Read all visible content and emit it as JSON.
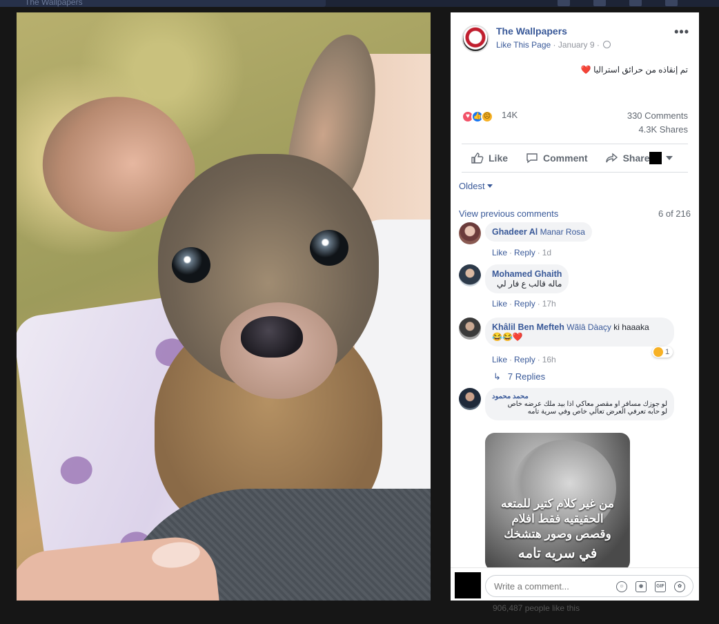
{
  "background": {
    "tab_title": "The Wallpapers",
    "bottom_text": "906,487 people like this"
  },
  "post": {
    "page_name": "The Wallpapers",
    "like_page": "Like This Page",
    "date": "January 9",
    "text": "تم إنقاذه من حرائق استراليا",
    "heart": "❤️",
    "reaction_count": "14K",
    "comments_count": "330 Comments",
    "shares_count": "4.3K Shares",
    "actions": {
      "like": "Like",
      "comment": "Comment",
      "share": "Share"
    }
  },
  "comments_section": {
    "sort_label": "Oldest",
    "view_previous": "View previous comments",
    "count": "6 of 216",
    "comments": [
      {
        "name": "Ghadeer Al",
        "tag": "Manar Rosa",
        "text": "",
        "like": "Like",
        "reply": "Reply",
        "time": "1d"
      },
      {
        "name": "Mohamed Ghaith",
        "tag": "",
        "text": "ماله قالب ع فار لي",
        "like": "Like",
        "reply": "Reply",
        "time": "17h"
      },
      {
        "name": "Khâlil Ben Mefteh",
        "tag": "Wãlâ Dàaçy",
        "text": "ki haaaka",
        "emojis": "😂😂❤️",
        "like": "Like",
        "reply": "Reply",
        "time": "16h",
        "reaction_count": "1"
      },
      {
        "name": "محمد محمود",
        "tag": "",
        "text": "لو جوزك مسافر او مقصر معاكي اذا بيد ملك عرضه خاص",
        "text2": "لو حابه تعرفي العرض تعالي خاص وفي سرية تامه"
      }
    ],
    "replies_label": "7 Replies",
    "image_text": [
      "من غير كلام كتير للمتعه",
      "الحقيقيه فقط افلام",
      "وقصص وصور هتشخك",
      "في سريه تامه"
    ]
  },
  "composer": {
    "placeholder": "Write a comment..."
  },
  "colors": {
    "link": "#385898",
    "muted": "#90949c",
    "accent_like": "#1877f2"
  }
}
